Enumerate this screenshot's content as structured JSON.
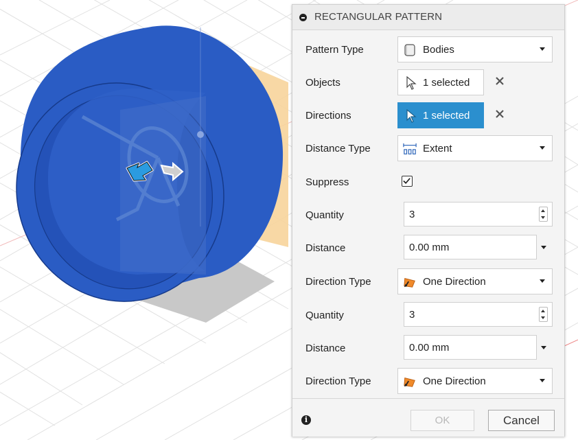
{
  "dialog": {
    "title": "RECTANGULAR PATTERN",
    "pattern_type": {
      "label": "Pattern Type",
      "value": "Bodies"
    },
    "objects": {
      "label": "Objects",
      "value": "1 selected"
    },
    "directions": {
      "label": "Directions",
      "value": "1 selected"
    },
    "distance_type": {
      "label": "Distance Type",
      "value": "Extent"
    },
    "suppress": {
      "label": "Suppress",
      "checked": true
    },
    "dir1": {
      "quantity": {
        "label": "Quantity",
        "value": "3"
      },
      "distance": {
        "label": "Distance",
        "value": "0.00 mm"
      },
      "direction_type": {
        "label": "Direction Type",
        "value": "One Direction"
      }
    },
    "dir2": {
      "quantity": {
        "label": "Quantity",
        "value": "3"
      },
      "distance": {
        "label": "Distance",
        "value": "0.00 mm"
      },
      "direction_type": {
        "label": "Direction Type",
        "value": "One Direction"
      }
    },
    "footer": {
      "ok_label": "OK",
      "cancel_label": "Cancel"
    }
  },
  "colors": {
    "body_blue": "#2a5cc4",
    "selected_blue": "#2b8fce",
    "plane_orange": "#f7d49b"
  },
  "icons": [
    "collapse-icon",
    "body-icon",
    "cursor-icon",
    "close-icon",
    "extent-icon",
    "checkbox-check-icon",
    "direction-icon",
    "info-icon",
    "move-arrow-icon"
  ]
}
